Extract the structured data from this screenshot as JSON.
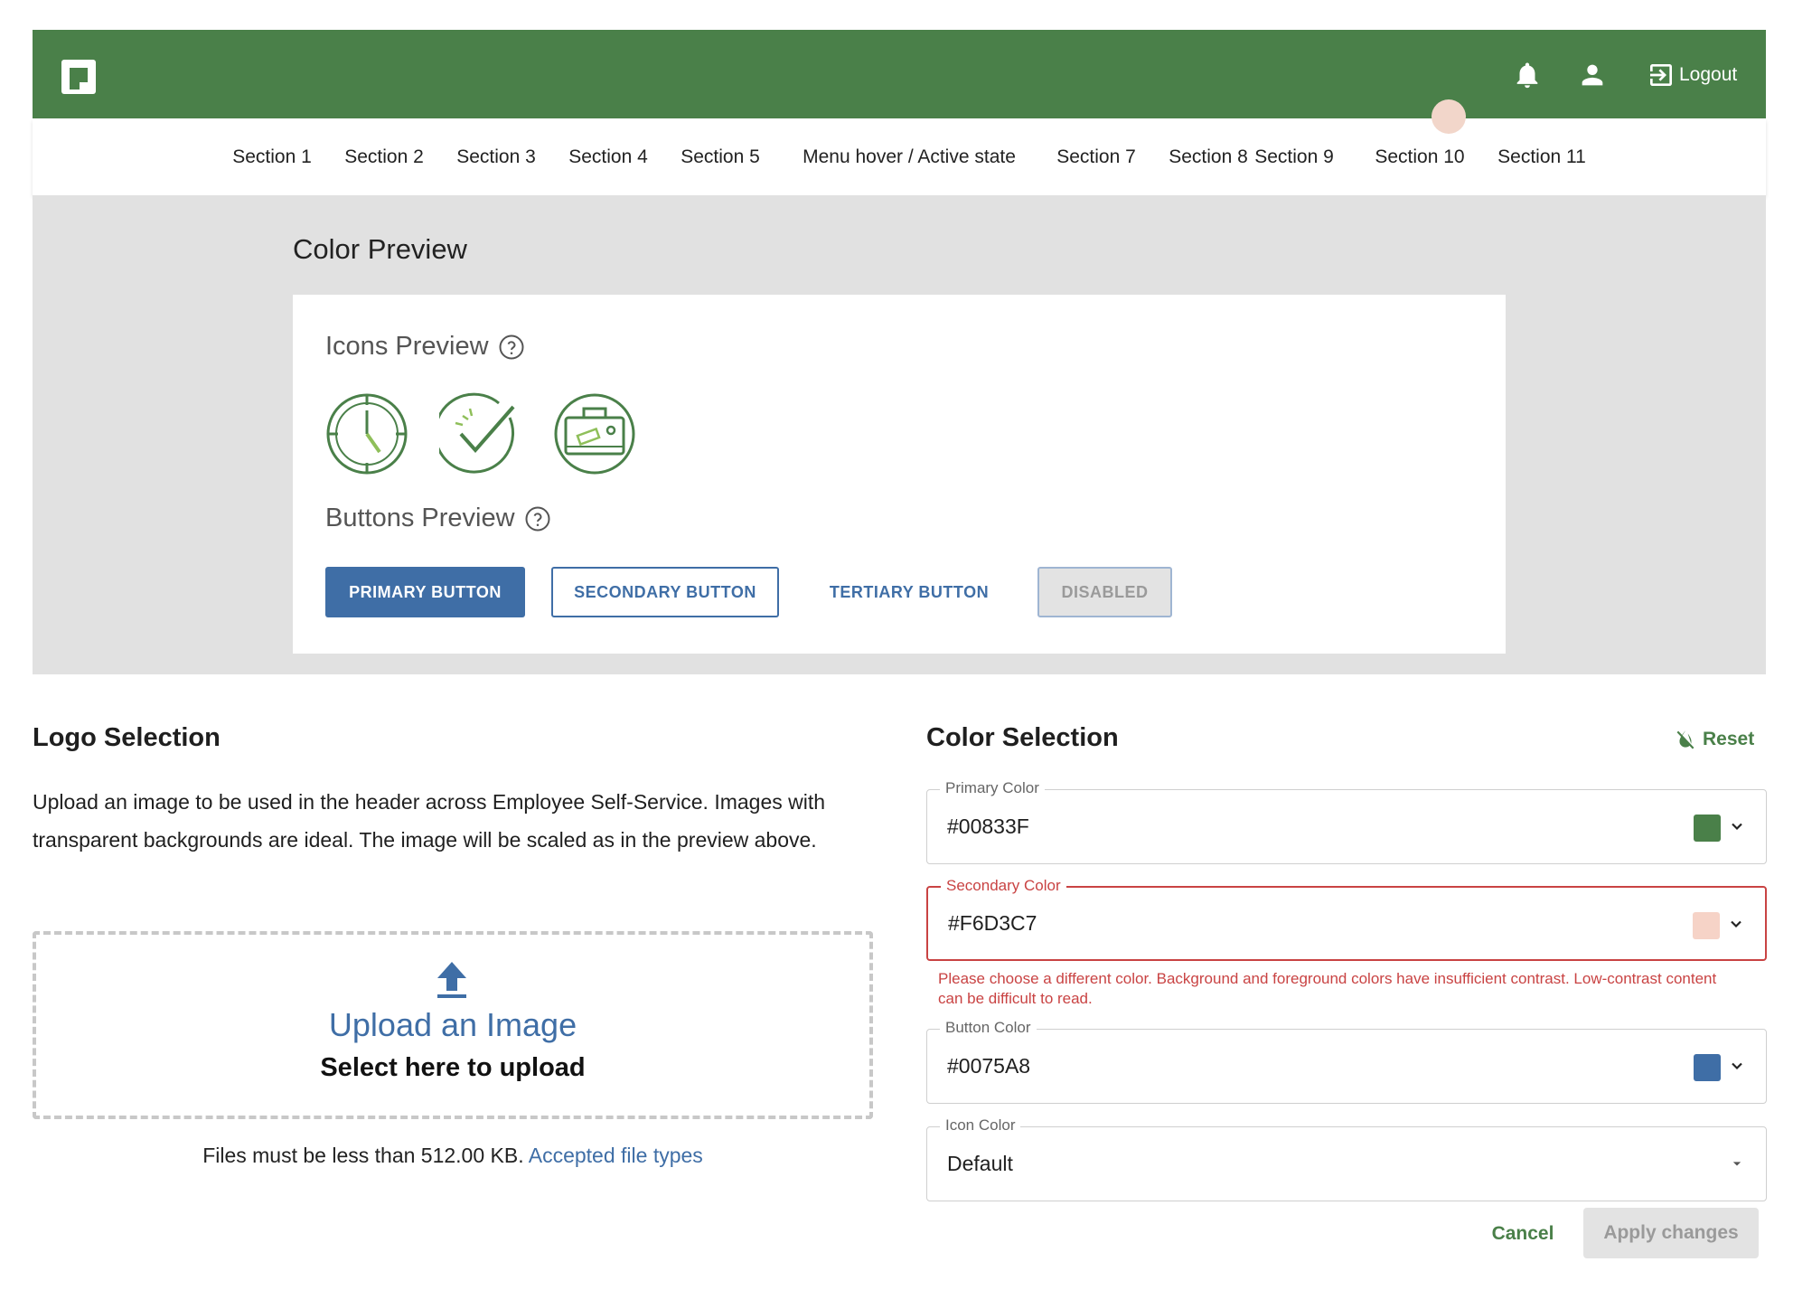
{
  "header": {
    "logout_label": "Logout",
    "colors": {
      "bar": "#4a8049"
    }
  },
  "nav": {
    "items": [
      {
        "label": "Section 1"
      },
      {
        "label": "Section 2"
      },
      {
        "label": "Section 3"
      },
      {
        "label": "Section 4"
      },
      {
        "label": "Section 5"
      },
      {
        "label": "Menu hover / Active state"
      },
      {
        "label": "Section 7"
      },
      {
        "label": "Section 8"
      },
      {
        "label": "Section 9",
        "active": true
      },
      {
        "label": "Section 10"
      },
      {
        "label": "Section 11"
      }
    ]
  },
  "preview": {
    "title": "Color Preview",
    "icons_title": "Icons Preview",
    "icons": [
      "clock-icon",
      "check-circle-icon",
      "briefcase-icon"
    ],
    "buttons_title": "Buttons Preview",
    "buttons": {
      "primary": "PRIMARY BUTTON",
      "secondary": "SECONDARY BUTTON",
      "tertiary": "TERTIARY BUTTON",
      "disabled": "DISABLED"
    }
  },
  "logo_selection": {
    "title": "Logo Selection",
    "description": "Upload an image to be used in the header across Employee Self-Service. Images with transparent backgrounds are ideal. The image will be scaled as in the preview above.",
    "upload_title": "Upload an Image",
    "upload_subtitle": "Select here to upload",
    "file_note": "Files must be less than 512.00 KB.",
    "file_types_link": "Accepted file types"
  },
  "color_selection": {
    "title": "Color Selection",
    "reset_label": "Reset",
    "fields": [
      {
        "label": "Primary Color",
        "value": "#00833F",
        "swatch": "#4a8049"
      },
      {
        "label": "Secondary Color",
        "value": "#F6D3C7",
        "swatch": "#f6d3c7",
        "error": true
      },
      {
        "label": "Button Color",
        "value": "#0075A8",
        "swatch": "#3f6ea6"
      },
      {
        "label": "Icon Color",
        "value": "Default"
      }
    ],
    "error_message": "Please choose a different color. Background and foreground colors have insufficient contrast. Low-contrast content can be difficult to read.",
    "cancel_label": "Cancel",
    "apply_label": "Apply changes"
  }
}
